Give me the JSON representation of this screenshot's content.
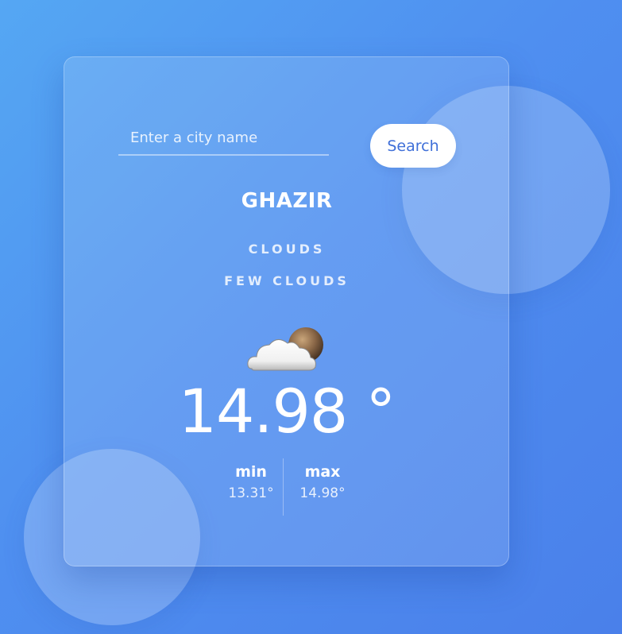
{
  "search": {
    "placeholder": "Enter a city name",
    "button_label": "Search"
  },
  "weather": {
    "city": "GHAZIR",
    "main": "CLOUDS",
    "description": "FEW CLOUDS",
    "icon": "few-clouds-icon",
    "temperature": "14.98 °",
    "min_label": "min",
    "min_value": "13.31°",
    "max_label": "max",
    "max_value": "14.98°"
  },
  "colors": {
    "background_start": "#55a7f3",
    "background_end": "#4a80ea",
    "accent": "#3f6fd8",
    "text": "#ffffff"
  }
}
